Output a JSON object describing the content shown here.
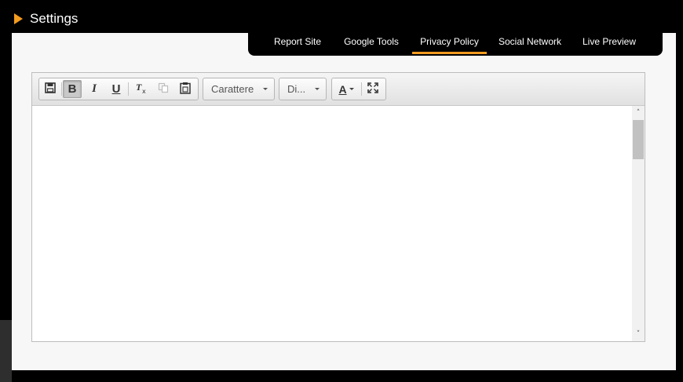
{
  "header": {
    "title": "Settings"
  },
  "tabs": [
    {
      "label": "Report Site",
      "active": false
    },
    {
      "label": "Google Tools",
      "active": false
    },
    {
      "label": "Privacy Policy",
      "active": true
    },
    {
      "label": "Social Network",
      "active": false
    },
    {
      "label": "Live Preview",
      "active": false
    }
  ],
  "toolbar": {
    "bold_label": "B",
    "italic_label": "I",
    "underline_label": "U",
    "bold_pressed": true,
    "font_combo": {
      "value": "Carattere"
    },
    "size_combo": {
      "value": "Di..."
    },
    "text_color_label": "A"
  },
  "editor": {
    "content": ""
  },
  "colors": {
    "accent": "#f39c1f",
    "panel": "#f7f7f7",
    "background": "#000000"
  }
}
